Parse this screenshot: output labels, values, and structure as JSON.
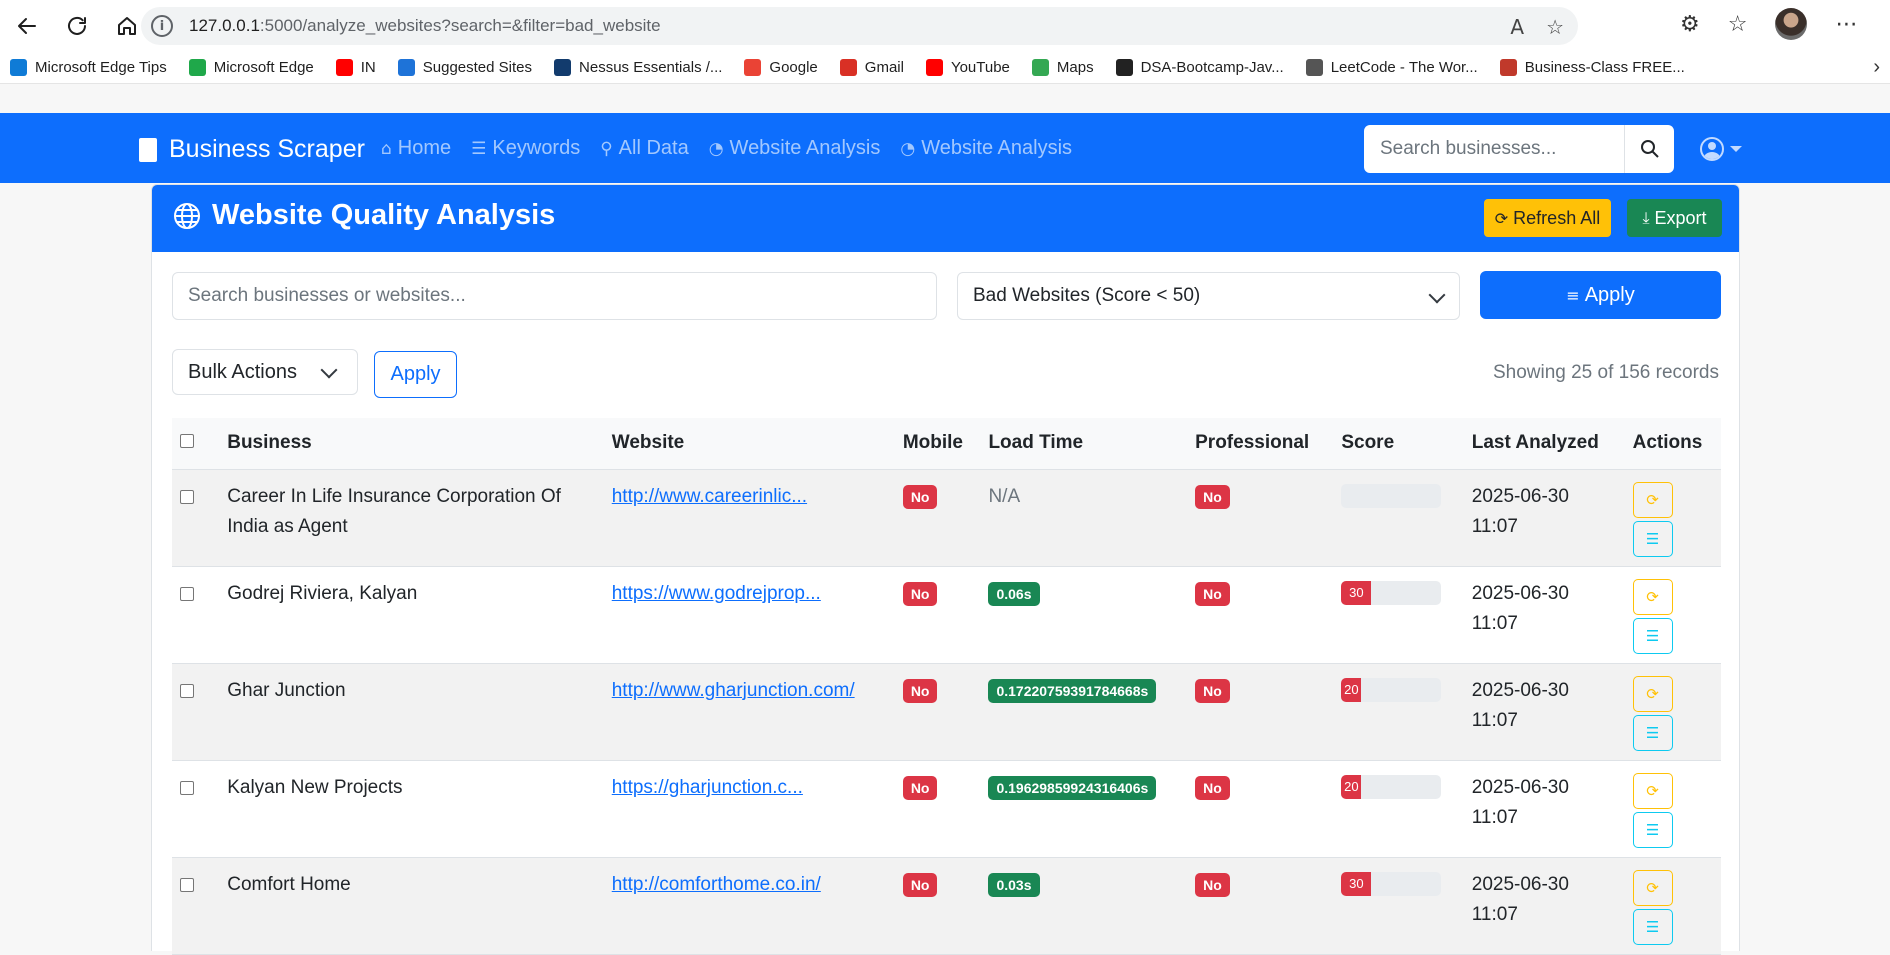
{
  "browser": {
    "url_host": "127.0.0.1",
    "url_rest": ":5000/analyze_websites?search=&filter=bad_website",
    "bookmarks": [
      {
        "label": "Microsoft Edge Tips",
        "color": "#0f7bd6"
      },
      {
        "label": "Microsoft Edge",
        "color": "#1fa84a"
      },
      {
        "label": "IN",
        "color": "#ff0000"
      },
      {
        "label": "Suggested Sites",
        "color": "#1e73d8"
      },
      {
        "label": "Nessus Essentials /...",
        "color": "#123b6d"
      },
      {
        "label": "Google",
        "color": "#ea4335"
      },
      {
        "label": "Gmail",
        "color": "#d93025"
      },
      {
        "label": "YouTube",
        "color": "#ff0000"
      },
      {
        "label": "Maps",
        "color": "#34a853"
      },
      {
        "label": "DSA-Bootcamp-Jav...",
        "color": "#222222"
      },
      {
        "label": "LeetCode - The Wor...",
        "color": "#555555"
      },
      {
        "label": "Business-Class FREE...",
        "color": "#c0392b"
      }
    ]
  },
  "navbar": {
    "brand": "Business Scraper",
    "links": [
      "Home",
      "Keywords",
      "All Data",
      "Website Analysis",
      "Website Analysis"
    ],
    "search_placeholder": "Search businesses..."
  },
  "card": {
    "title": "Website Quality Analysis",
    "refresh_label": "Refresh All",
    "export_label": "Export",
    "search_placeholder": "Search businesses or websites...",
    "filter_value": "Bad Websites (Score < 50)",
    "apply_label": "Apply",
    "bulk_label": "Bulk Actions",
    "bulk_apply_label": "Apply",
    "records_text": "Showing 25 of 156 records"
  },
  "table": {
    "headers": [
      "Business",
      "Website",
      "Mobile",
      "Load Time",
      "Professional",
      "Score",
      "Last Analyzed",
      "Actions"
    ],
    "rows": [
      {
        "business": "Career In Life Insurance Corporation Of India as Agent",
        "website": "http://www.careerinlic...",
        "mobile": "No",
        "load": "N/A",
        "professional": "No",
        "score": "",
        "date": "2025-06-30",
        "time": "11:07"
      },
      {
        "business": "Godrej Riviera, Kalyan",
        "website": "https://www.godrejprop...",
        "mobile": "No",
        "load": "0.06s",
        "professional": "No",
        "score": "30",
        "date": "2025-06-30",
        "time": "11:07"
      },
      {
        "business": "Ghar Junction",
        "website": "http://www.gharjunction.com/",
        "mobile": "No",
        "load": "0.17220759391784668s",
        "professional": "No",
        "score": "20",
        "date": "2025-06-30",
        "time": "11:07"
      },
      {
        "business": "Kalyan New Projects",
        "website": "https://gharjunction.c...",
        "mobile": "No",
        "load": "0.19629859924316406s",
        "professional": "No",
        "score": "20",
        "date": "2025-06-30",
        "time": "11:07"
      },
      {
        "business": "Comfort Home",
        "website": "http://comforthome.co.in/",
        "mobile": "No",
        "load": "0.03s",
        "professional": "No",
        "score": "30",
        "date": "2025-06-30",
        "time": "11:07"
      }
    ]
  },
  "colors": {
    "primary": "#0d6efd",
    "danger": "#dc3545",
    "success": "#198754",
    "warning": "#ffc107",
    "info": "#0dcaf0"
  }
}
